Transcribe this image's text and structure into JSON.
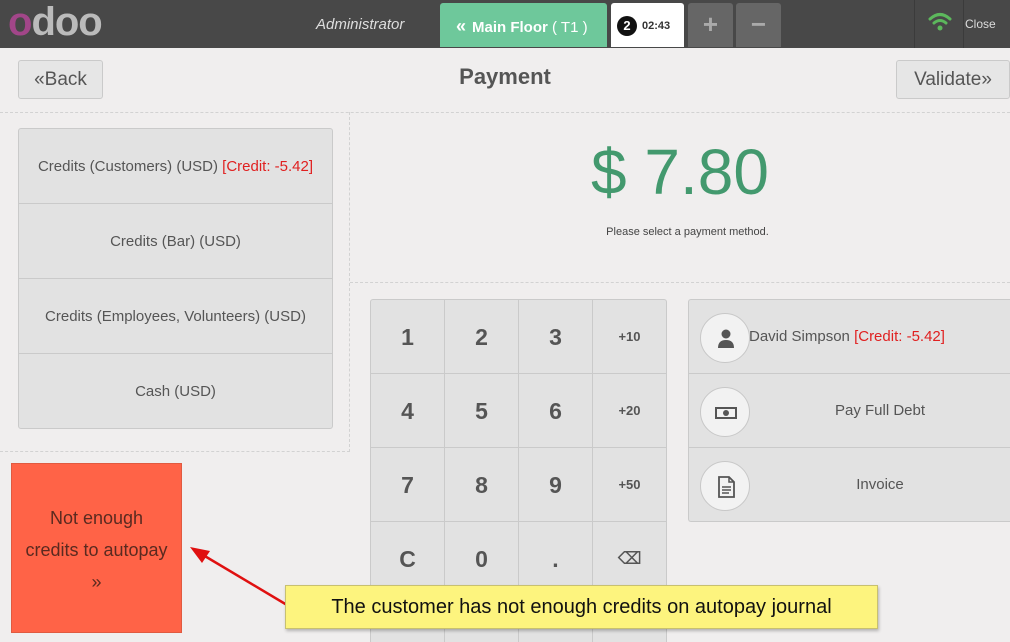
{
  "topbar": {
    "logo": "odoo",
    "user": "Administrator",
    "order_tab_label": "Main Floor",
    "order_tab_table": "( T1 )",
    "order_number": "2",
    "order_time": "02:43",
    "add_label": "+",
    "remove_label": "−",
    "close_label": "Close",
    "icons": {
      "back_to_floor": "double-chevron-left-icon",
      "connection": "wifi-icon"
    }
  },
  "header": {
    "back_label": "Back",
    "title": "Payment",
    "validate_label": "Validate"
  },
  "payment_methods": [
    {
      "label": "Credits (Customers) (USD)",
      "credit": "[Credit: -5.42]"
    },
    {
      "label": "Credits (Bar) (USD)",
      "credit": ""
    },
    {
      "label": "Credits (Employees, Volunteers) (USD)",
      "credit": ""
    },
    {
      "label": "Cash (USD)",
      "credit": ""
    }
  ],
  "summary": {
    "total": "$ 7.80",
    "hint": "Please select a payment method."
  },
  "numpad": {
    "keys": [
      "1",
      "2",
      "3",
      "+10",
      "4",
      "5",
      "6",
      "+20",
      "7",
      "8",
      "9",
      "+50",
      "C",
      "0",
      ".",
      "⌫"
    ]
  },
  "actions": {
    "customer": {
      "name": "David Simpson",
      "credit": "[Credit: -5.42]",
      "icon": "user-icon"
    },
    "pay_full_debt": {
      "label": "Pay Full Debt",
      "icon": "money-icon"
    },
    "invoice": {
      "label": "Invoice",
      "icon": "document-icon"
    }
  },
  "warning": {
    "line1": "Not enough",
    "line2": "credits to autopay",
    "line3": "»"
  },
  "annotation": {
    "text": "The customer has not enough credits on autopay journal"
  },
  "colors": {
    "topbar": "#484848",
    "order_tab": "#6ec89b",
    "total": "#43996e",
    "warning": "#ff6347",
    "credit": "#e02020",
    "callout": "#fdf47e",
    "arrow": "#e01010"
  }
}
